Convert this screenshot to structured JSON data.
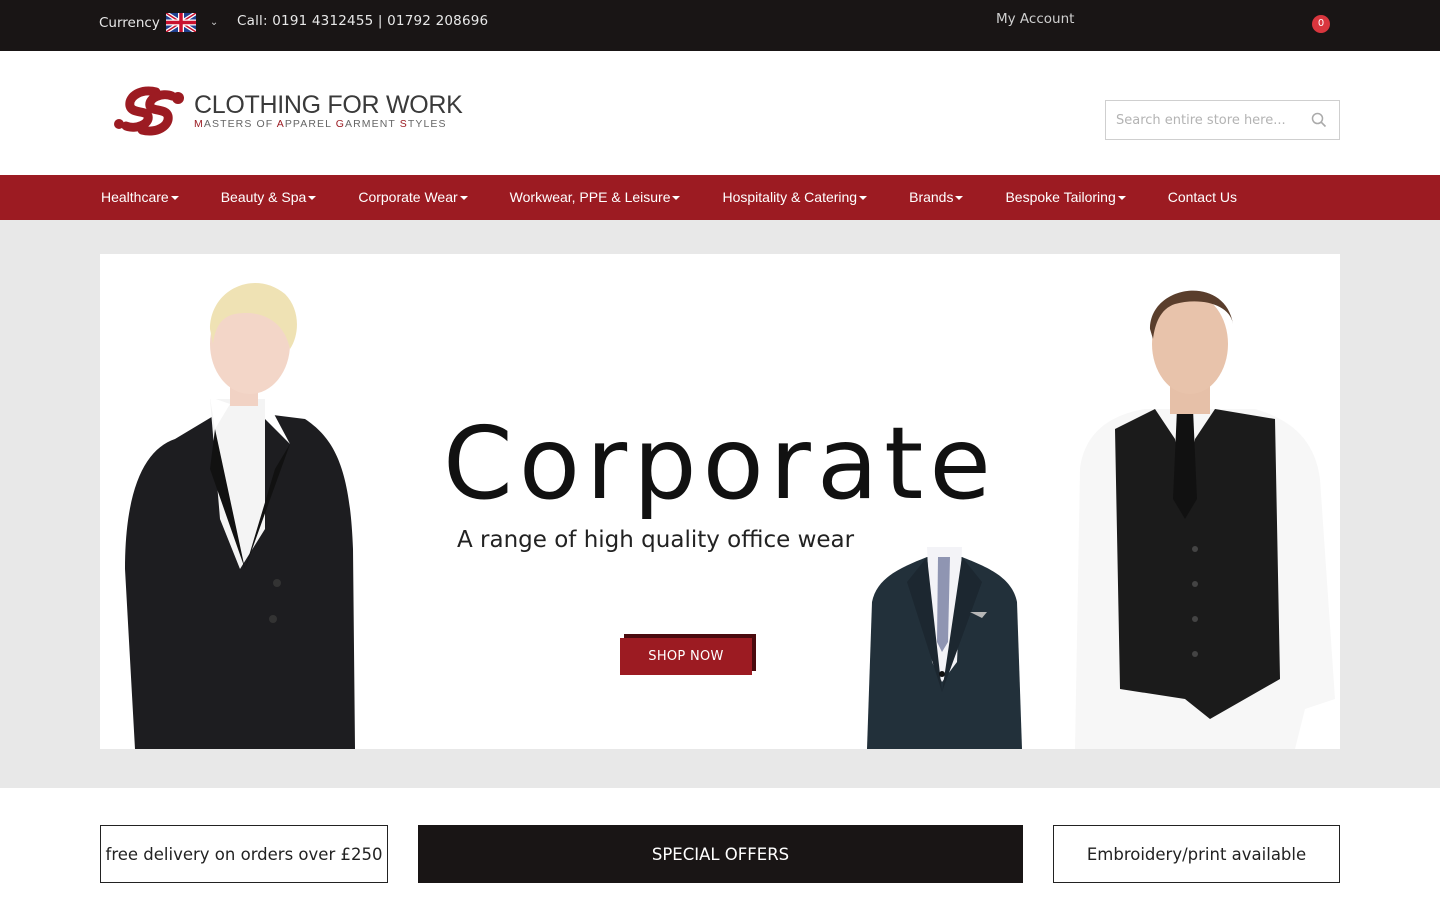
{
  "topbar": {
    "currency_label": "Currency",
    "currency_flag": "uk-flag-icon",
    "call_text": "Call: 0191 4312455 | 01792 208696",
    "account_label": "My Account",
    "cart_count": "0"
  },
  "header": {
    "logo_title": "CLOTHING FOR WORK",
    "logo_tagline_parts": [
      "M",
      "ASTERS OF ",
      "A",
      "PPAREL ",
      "G",
      "ARMENT ",
      "S",
      "TYLES"
    ],
    "search_placeholder": "Search entire store here...",
    "search_value": ""
  },
  "nav": {
    "items": [
      {
        "label": "Healthcare",
        "dropdown": true
      },
      {
        "label": "Beauty & Spa",
        "dropdown": true
      },
      {
        "label": "Corporate Wear",
        "dropdown": true
      },
      {
        "label": "Workwear, PPE & Leisure",
        "dropdown": true
      },
      {
        "label": "Hospitality & Catering",
        "dropdown": true
      },
      {
        "label": "Brands",
        "dropdown": true
      },
      {
        "label": "Bespoke Tailoring",
        "dropdown": true
      },
      {
        "label": "Contact Us",
        "dropdown": false
      }
    ]
  },
  "hero": {
    "headline": "Corporate",
    "subheadline": "A range of high quality office wear",
    "cta_label": "SHOP NOW"
  },
  "promos": {
    "delivery": "free delivery on orders over £250",
    "special_offers": "SPECIAL OFFERS",
    "embroidery": "Embroidery/print available"
  },
  "colors": {
    "brand_red": "#9c1b22",
    "topbar_bg": "#191515",
    "badge_red": "#d9363e",
    "hero_bg": "#e8e8e8"
  }
}
